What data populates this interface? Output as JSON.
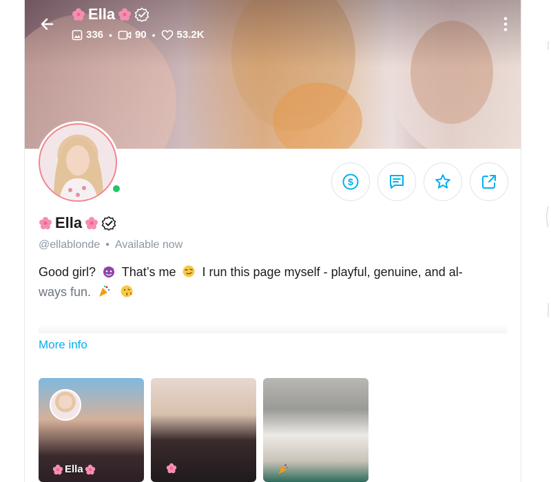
{
  "header": {
    "name": "Ella",
    "stats": {
      "photos": "336",
      "videos": "90",
      "likes": "53.2K"
    },
    "icons": [
      "back-arrow-icon",
      "photo-icon",
      "video-icon",
      "heart-icon",
      "more-vertical-icon",
      "flower-emoji",
      "verified-icon"
    ]
  },
  "profile": {
    "name": "Ella",
    "handle": "@ellablonde",
    "separator": "•",
    "status": "Available now",
    "bio_line1_a": "Good girl?",
    "bio_line1_b": "That’s me",
    "bio_line1_c": "I run this page myself - playful, genuine, and al-",
    "bio_line2": "ways fun.",
    "more_info": "More info",
    "online": true
  },
  "actions": [
    {
      "name": "tip",
      "icon": "dollar-circle-icon"
    },
    {
      "name": "message",
      "icon": "chat-icon"
    },
    {
      "name": "favorite",
      "icon": "star-icon"
    },
    {
      "name": "share",
      "icon": "share-icon"
    }
  ],
  "thumbnails": [
    {
      "label": "Ella"
    },
    {
      "label": ""
    },
    {
      "label": ""
    }
  ],
  "colors": {
    "accent": "#00aff0",
    "online": "#25c46a",
    "avatar_ring": "#f0868f",
    "muted": "#8a96a3"
  }
}
